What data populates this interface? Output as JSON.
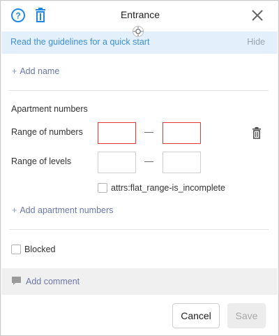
{
  "header": {
    "title": "Entrance",
    "help_icon": "help-circle-icon",
    "delete_icon": "trash-icon",
    "close_icon": "close-icon",
    "drag_icon": "drag-handle-icon",
    "accent_color": "#1e88e5"
  },
  "banner": {
    "text": "Read the guidelines for a quick start",
    "hide_label": "Hide",
    "background": "#e3f0fc"
  },
  "add_name": {
    "plus": "+",
    "label": "Add name"
  },
  "apartments": {
    "section_title": "Apartment numbers",
    "range_numbers_label": "Range of numbers",
    "range_levels_label": "Range of levels",
    "dash": "—",
    "numbers_from": "",
    "numbers_to": "",
    "levels_from": "",
    "levels_to": "",
    "incomplete_label": "attrs:flat_range-is_incomplete",
    "incomplete_checked": false,
    "delete_icon": "trash-icon",
    "error_color": "#e53935"
  },
  "add_apartments": {
    "plus": "+",
    "label": "Add apartment numbers"
  },
  "blocked": {
    "label": "Blocked",
    "checked": false
  },
  "comment": {
    "icon": "comment-icon",
    "label": "Add comment"
  },
  "footer": {
    "cancel_label": "Cancel",
    "save_label": "Save"
  }
}
